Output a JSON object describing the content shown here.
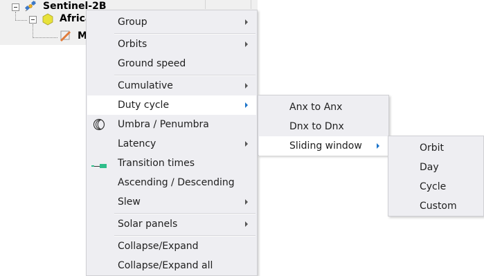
{
  "tree": {
    "satellite_label": "Sentinel-2B",
    "region_label": "Africa",
    "child_label": "M"
  },
  "context_menu": {
    "items": [
      {
        "label": "Group"
      },
      {
        "label": "Orbits"
      },
      {
        "label": "Ground speed"
      },
      {
        "label": "Cumulative"
      },
      {
        "label": "Duty cycle"
      },
      {
        "label": "Umbra / Penumbra"
      },
      {
        "label": "Latency"
      },
      {
        "label": "Transition times"
      },
      {
        "label": "Ascending / Descending"
      },
      {
        "label": "Slew"
      },
      {
        "label": "Solar panels"
      },
      {
        "label": "Collapse/Expand"
      },
      {
        "label": "Collapse/Expand all"
      }
    ]
  },
  "duty_cycle_submenu": {
    "items": [
      {
        "label": "Anx to Anx"
      },
      {
        "label": "Dnx to Dnx"
      },
      {
        "label": "Sliding window"
      }
    ]
  },
  "sliding_window_submenu": {
    "items": [
      {
        "label": "Orbit"
      },
      {
        "label": "Day"
      },
      {
        "label": "Cycle"
      },
      {
        "label": "Custom"
      }
    ]
  },
  "colors": {
    "menu_background": "#eeeef2",
    "hover_background": "#ffffff",
    "active_arrow": "#1a73c9",
    "transition_icon": "#2ebd8a",
    "region_icon": "#e8e23a"
  },
  "icons": {
    "satellite": "satellite-icon",
    "region": "hexagon-icon",
    "child": "pen-icon",
    "umbra": "moon-eclipse-icon",
    "transition": "transition-bar-icon"
  }
}
